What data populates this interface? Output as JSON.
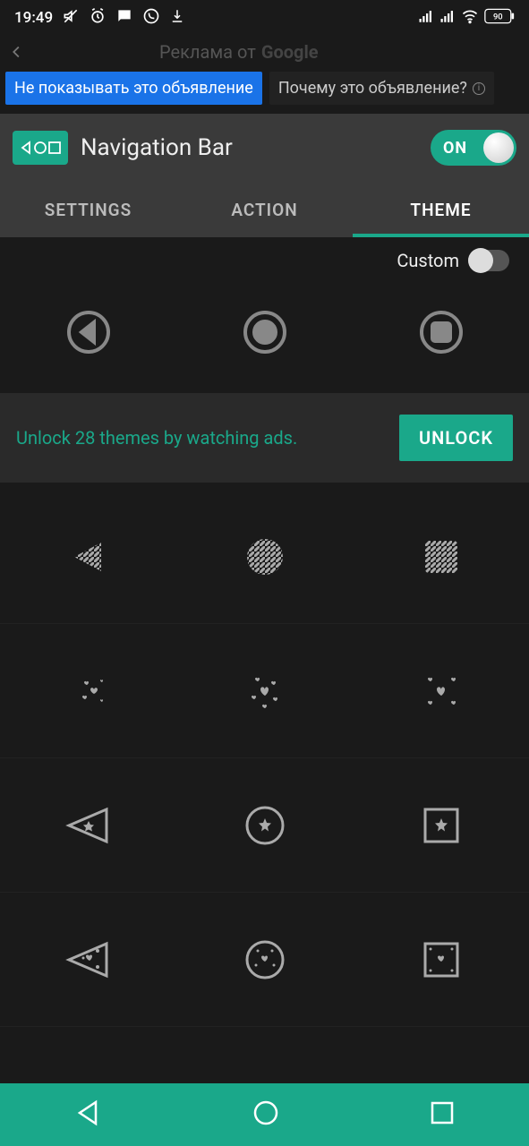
{
  "status": {
    "time": "19:49",
    "battery": "90"
  },
  "ad": {
    "prefix": "Реклама от",
    "brand": "Google",
    "dont_show": "Не показывать это объявление",
    "why": "Почему это объявление?"
  },
  "header": {
    "title": "Navigation Bar",
    "toggle": "ON"
  },
  "tabs": {
    "settings": "SETTINGS",
    "action": "ACTION",
    "theme": "THEME"
  },
  "custom": {
    "label": "Custom"
  },
  "unlock": {
    "text": "Unlock 28 themes by watching ads.",
    "button": "UNLOCK"
  },
  "colors": {
    "accent": "#1aa88a"
  }
}
